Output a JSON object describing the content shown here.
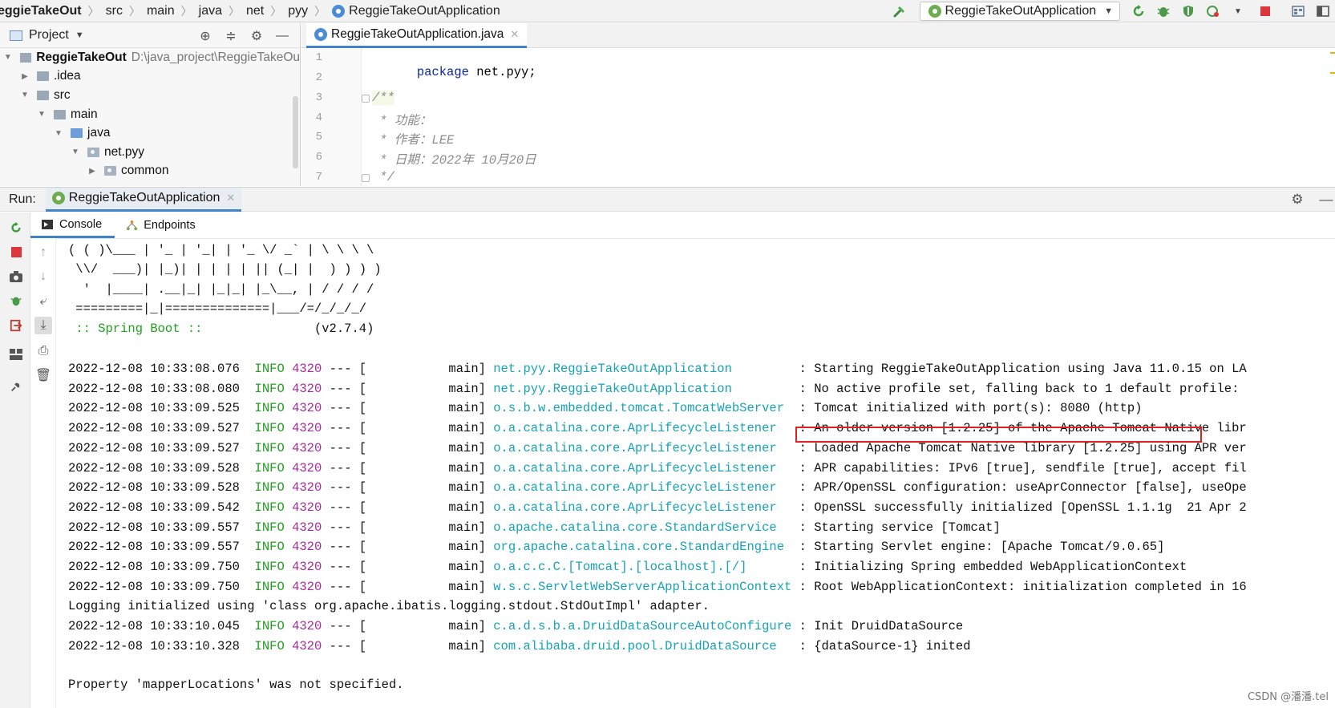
{
  "navbar": {
    "breadcrumbs": [
      "eggieTakeOut",
      "src",
      "main",
      "java",
      "net",
      "pyy",
      "ReggieTakeOutApplication"
    ],
    "run_config": "ReggieTakeOutApplication"
  },
  "project": {
    "title": "Project",
    "tree": [
      {
        "label": "ReggieTakeOut",
        "path": "D:\\java_project\\ReggieTakeOu",
        "depth": 0,
        "expanded": true
      },
      {
        "label": ".idea",
        "depth": 1,
        "expanded": false
      },
      {
        "label": "src",
        "depth": 1,
        "expanded": true
      },
      {
        "label": "main",
        "depth": 2,
        "expanded": true
      },
      {
        "label": "java",
        "depth": 3,
        "expanded": true
      },
      {
        "label": "net.pyy",
        "depth": 4,
        "expanded": true
      },
      {
        "label": "common",
        "depth": 5,
        "expanded": false
      }
    ]
  },
  "editor": {
    "tab": "ReggieTakeOutApplication.java",
    "line_numbers": [
      "1",
      "2",
      "3",
      "4",
      "5",
      "6",
      "7"
    ],
    "code": {
      "l1_kw": "package",
      "l1_rest": " net.pyy;",
      "l3": "/**",
      "l4": " * 功能：",
      "l5": " * 作者：LEE",
      "l6": " * 日期：2022年 10月20日",
      "l7": " */"
    }
  },
  "run": {
    "label": "Run:",
    "tab": "ReggieTakeOutApplication",
    "console_tab": "Console",
    "endpoints_tab": "Endpoints"
  },
  "console": {
    "banner": [
      "( ( )\\___ | '_ | '_| | '_ \\/ _` | \\ \\ \\ \\",
      " \\\\/  ___)| |_)| | | | | || (_| |  ) ) ) )",
      "  '  |____| .__|_| |_|_| |_\\__, | / / / /",
      " =========|_|==============|___/=/_/_/_/"
    ],
    "spring_label": " :: Spring Boot :: ",
    "spring_version": "              (v2.7.4)",
    "log_lines": [
      {
        "ts": "2022-12-08 10:33:08.076",
        "level": "INFO",
        "pid": "4320",
        "sep": " --- [           main] ",
        "logger": "net.pyy.ReggieTakeOutApplication        ",
        "msg": " : Starting ReggieTakeOutApplication using Java 11.0.15 on LA"
      },
      {
        "ts": "2022-12-08 10:33:08.080",
        "level": "INFO",
        "pid": "4320",
        "sep": " --- [           main] ",
        "logger": "net.pyy.ReggieTakeOutApplication        ",
        "msg": " : No active profile set, falling back to 1 default profile:"
      },
      {
        "ts": "2022-12-08 10:33:09.525",
        "level": "INFO",
        "pid": "4320",
        "sep": " --- [           main] ",
        "logger": "o.s.b.w.embedded.tomcat.TomcatWebServer ",
        "msg": " : Tomcat initialized with port(s): 8080 (http)"
      },
      {
        "ts": "2022-12-08 10:33:09.527",
        "level": "INFO",
        "pid": "4320",
        "sep": " --- [           main] ",
        "logger": "o.a.catalina.core.AprLifecycleListener  ",
        "msg": " : An older version [1.2.25] of the Apache Tomcat Native libr"
      },
      {
        "ts": "2022-12-08 10:33:09.527",
        "level": "INFO",
        "pid": "4320",
        "sep": " --- [           main] ",
        "logger": "o.a.catalina.core.AprLifecycleListener  ",
        "msg": " : Loaded Apache Tomcat Native library [1.2.25] using APR ver"
      },
      {
        "ts": "2022-12-08 10:33:09.528",
        "level": "INFO",
        "pid": "4320",
        "sep": " --- [           main] ",
        "logger": "o.a.catalina.core.AprLifecycleListener  ",
        "msg": " : APR capabilities: IPv6 [true], sendfile [true], accept fil"
      },
      {
        "ts": "2022-12-08 10:33:09.528",
        "level": "INFO",
        "pid": "4320",
        "sep": " --- [           main] ",
        "logger": "o.a.catalina.core.AprLifecycleListener  ",
        "msg": " : APR/OpenSSL configuration: useAprConnector [false], useOpe"
      },
      {
        "ts": "2022-12-08 10:33:09.542",
        "level": "INFO",
        "pid": "4320",
        "sep": " --- [           main] ",
        "logger": "o.a.catalina.core.AprLifecycleListener  ",
        "msg": " : OpenSSL successfully initialized [OpenSSL 1.1.1g  21 Apr 2"
      },
      {
        "ts": "2022-12-08 10:33:09.557",
        "level": "INFO",
        "pid": "4320",
        "sep": " --- [           main] ",
        "logger": "o.apache.catalina.core.StandardService  ",
        "msg": " : Starting service [Tomcat]"
      },
      {
        "ts": "2022-12-08 10:33:09.557",
        "level": "INFO",
        "pid": "4320",
        "sep": " --- [           main] ",
        "logger": "org.apache.catalina.core.StandardEngine ",
        "msg": " : Starting Servlet engine: [Apache Tomcat/9.0.65]"
      },
      {
        "ts": "2022-12-08 10:33:09.750",
        "level": "INFO",
        "pid": "4320",
        "sep": " --- [           main] ",
        "logger": "o.a.c.c.C.[Tomcat].[localhost].[/]      ",
        "msg": " : Initializing Spring embedded WebApplicationContext"
      },
      {
        "ts": "2022-12-08 10:33:09.750",
        "level": "INFO",
        "pid": "4320",
        "sep": " --- [           main] ",
        "logger": "w.s.c.ServletWebServerApplicationContext",
        "msg": " : Root WebApplicationContext: initialization completed in 16"
      }
    ],
    "plain_line_1": "Logging initialized using 'class org.apache.ibatis.logging.stdout.StdOutImpl' adapter.",
    "log_lines_2": [
      {
        "ts": "2022-12-08 10:33:10.045",
        "level": "INFO",
        "pid": "4320",
        "sep": " --- [           main] ",
        "logger": "c.a.d.s.b.a.DruidDataSourceAutoConfigure",
        "msg": " : Init DruidDataSource"
      },
      {
        "ts": "2022-12-08 10:33:10.328",
        "level": "INFO",
        "pid": "4320",
        "sep": " --- [           main] ",
        "logger": "com.alibaba.druid.pool.DruidDataSource  ",
        "msg": " : {dataSource-1} inited"
      }
    ],
    "plain_line_2": "Property 'mapperLocations' was not specified."
  },
  "watermark": "CSDN @潘潘.tel",
  "colors": {
    "info": "#22a020",
    "pid": "#a52a99",
    "logger": "#17a2b8",
    "highlight": "#e02020",
    "tab_underline": "#4083c9"
  }
}
